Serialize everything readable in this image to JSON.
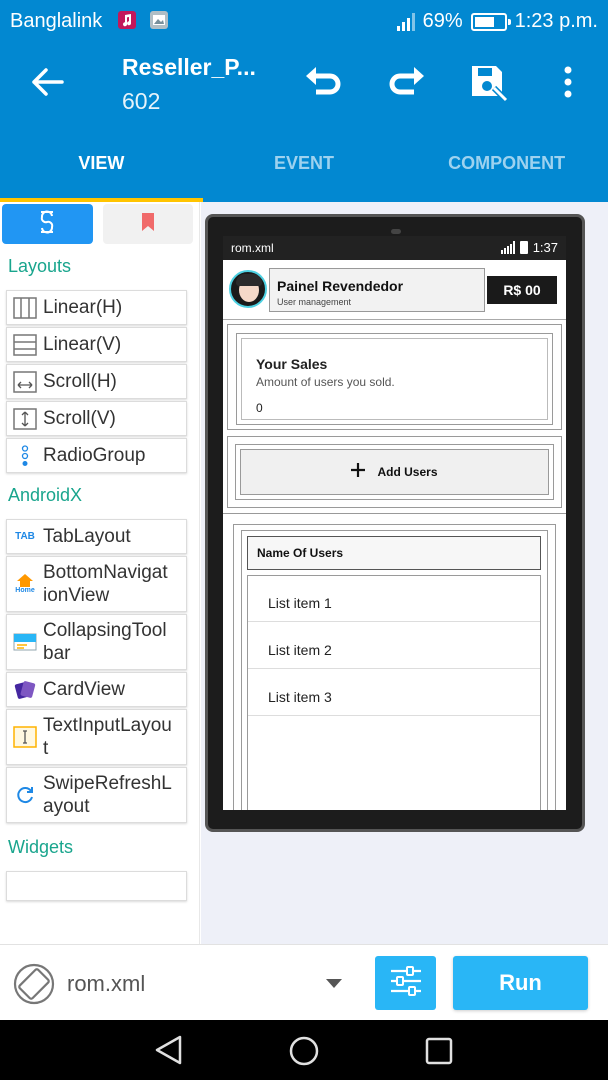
{
  "status_bar": {
    "carrier": "Banglalink",
    "battery_percent": "69%",
    "battery_level": 0.69,
    "time": "1:23 p.m."
  },
  "toolbar": {
    "title": "Reseller_P...",
    "subtitle": "602",
    "icons": [
      "back-arrow-icon",
      "undo-icon",
      "redo-icon",
      "save-icon",
      "more-vert-icon"
    ]
  },
  "tabs": [
    {
      "label": "VIEW",
      "active": true
    },
    {
      "label": "EVENT",
      "active": false
    },
    {
      "label": "COMPONENT",
      "active": false
    }
  ],
  "palette": {
    "tab_icons": [
      "layout-palette-icon",
      "bookmark-icon"
    ],
    "categories": [
      {
        "name": "Layouts",
        "items": [
          {
            "label": "Linear(H)",
            "icon": "linear-horizontal-icon"
          },
          {
            "label": "Linear(V)",
            "icon": "linear-vertical-icon"
          },
          {
            "label": "Scroll(H)",
            "icon": "scroll-horizontal-icon"
          },
          {
            "label": "Scroll(V)",
            "icon": "scroll-vertical-icon"
          },
          {
            "label": "RadioGroup",
            "icon": "radio-group-icon"
          }
        ]
      },
      {
        "name": "AndroidX",
        "items": [
          {
            "label": "TabLayout",
            "icon": "tab-layout-icon"
          },
          {
            "label": "BottomNavigationView",
            "line1": "BottomNavigat",
            "line2": "ionView",
            "icon": "bottom-navigation-icon",
            "home_text": "Home"
          },
          {
            "label": "CollapsingToolbar",
            "line1": "CollapsingTool",
            "line2": "bar",
            "icon": "collapsing-toolbar-icon"
          },
          {
            "label": "CardView",
            "icon": "card-view-icon"
          },
          {
            "label": "TextInputLayout",
            "line1": "TextInputLayou",
            "line2": "t",
            "icon": "text-input-layout-icon"
          },
          {
            "label": "SwipeRefreshLayout",
            "line1": "SwipeRefreshL",
            "line2": "ayout",
            "icon": "swipe-refresh-icon"
          }
        ]
      },
      {
        "name": "Widgets",
        "items": []
      }
    ],
    "tab_layout_icon_text": "TAB"
  },
  "preview": {
    "status": {
      "file": "rom.xml",
      "time": "1:37"
    },
    "header": {
      "title": "Painel Revendedor",
      "subtitle": "User management",
      "balance": "R$ 00"
    },
    "sales_card": {
      "title": "Your Sales",
      "description": "Amount of users you sold.",
      "count": "0"
    },
    "add_users_button": {
      "label": "Add Users",
      "icon": "plus-icon"
    },
    "users_list": {
      "header": "Name Of Users",
      "items": [
        "List item 1",
        "List item 2",
        "List item 3"
      ]
    }
  },
  "bottom_bar": {
    "file": "rom.xml",
    "run_label": "Run",
    "icons": [
      "rotate-screen-icon",
      "dropdown-arrow-icon",
      "settings-sliders-icon"
    ]
  },
  "nav_bar": {
    "icons": [
      "nav-back-icon",
      "nav-home-icon",
      "nav-recents-icon"
    ]
  },
  "colors": {
    "primary": "#0288d1",
    "accent": "#ffc400",
    "category_text": "#19a58d",
    "button": "#29b6f6",
    "preview_bg": "#eef0f8"
  }
}
